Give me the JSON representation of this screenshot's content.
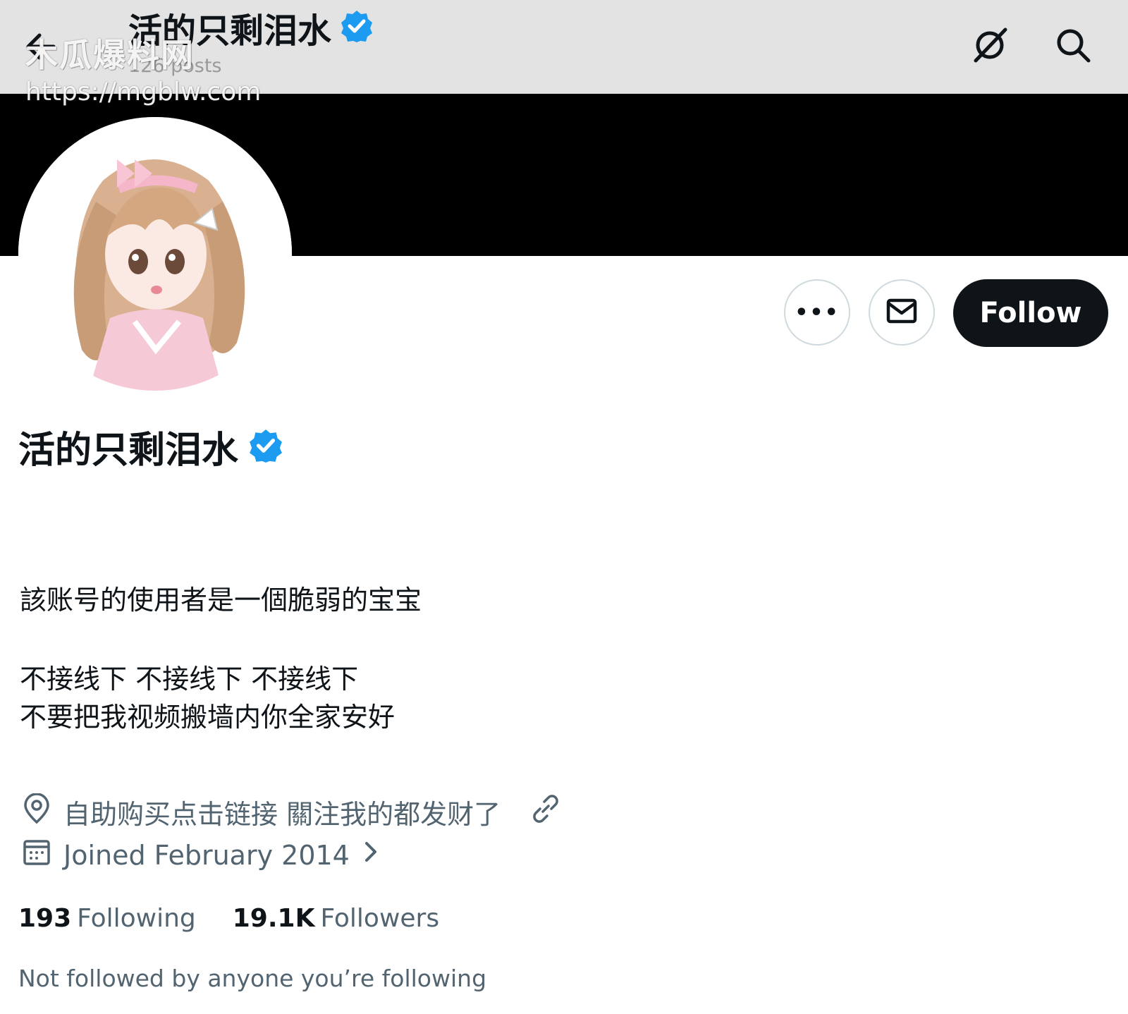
{
  "watermark": {
    "title": "木瓜爆料网",
    "url": "https://mgblw.com"
  },
  "header": {
    "display_name": "活的只剩泪水",
    "posts_count": "126 posts",
    "icons": [
      "back-arrow-icon",
      "grok-icon",
      "search-icon"
    ]
  },
  "actions": {
    "more_label": "•••",
    "dm_icon": "mail-icon",
    "follow_label": "Follow"
  },
  "profile": {
    "display_name": "活的只剩泪水",
    "verified": true,
    "bio": [
      "該账号的使用者是一個脆弱的宝宝",
      "不接线下 不接线下 不接线下",
      "不要把我视频搬墙内你全家安好"
    ],
    "location": "自助购买点击链接 關注我的都发财了",
    "joined": "Joined February 2014",
    "following_count": "193",
    "following_label": "Following",
    "followers_count": "19.1K",
    "followers_label": "Followers",
    "not_followed_note": "Not followed by anyone you’re following"
  },
  "colors": {
    "verified_blue": "#1d9bf0",
    "follow_button_bg": "#0f1419",
    "secondary_text": "#536471",
    "banner": "#000000",
    "topbar": "#e3e3e3"
  }
}
